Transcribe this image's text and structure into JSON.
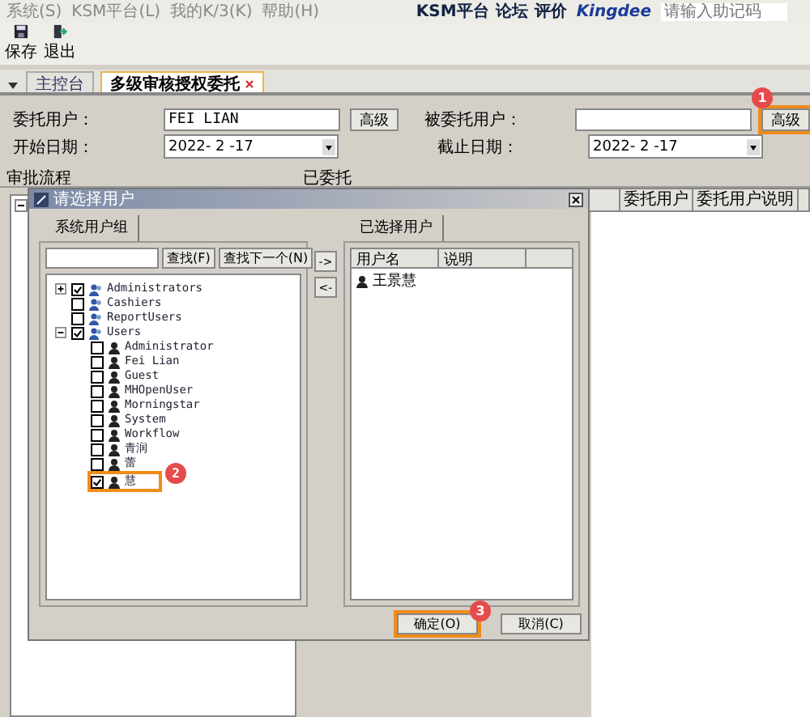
{
  "menu": [
    "系统(S)",
    "KSM平台(L)",
    "我的K/3(K)",
    "帮助(H)"
  ],
  "header_links": [
    "KSM平台",
    "论坛",
    "评价"
  ],
  "brand": "Kingdee",
  "search": {
    "placeholder": "请输入助记码"
  },
  "toolbar": [
    {
      "kind": "save",
      "label": "保存"
    },
    {
      "kind": "exit",
      "label": "退出"
    }
  ],
  "tabs": [
    {
      "label": "主控台",
      "selected": false,
      "closable": false
    },
    {
      "label": "多级审核授权委托",
      "selected": true,
      "closable": true
    }
  ],
  "form_rows": [
    [
      {
        "kind": "text",
        "label": "委托用户：",
        "value": "FEI LIAN",
        "button": "高级"
      },
      {
        "kind": "text",
        "label": "被委托用户：",
        "button": "高级",
        "callout": "1"
      }
    ],
    [
      {
        "kind": "date",
        "label": "开始日期：",
        "value": "2022- 2 -17"
      },
      {
        "kind": "date",
        "label": "截止日期：",
        "value": "2022- 2 -17"
      }
    ]
  ],
  "panels": {
    "left_title": "审批流程",
    "right_title": "已委托",
    "columns": [
      "委托用户",
      "委托用户说明"
    ]
  },
  "dialog": {
    "title": "请选择用户",
    "left_tab": "系统用户组",
    "search_buttons": [
      "查找(F)",
      "查找下一个(N)"
    ],
    "tree": [
      {
        "label": "Administrators",
        "checked": true,
        "expanded": false
      },
      {
        "label": "Cashiers",
        "checked": false
      },
      {
        "label": "ReportUsers",
        "checked": false
      },
      {
        "label": "Users",
        "checked": true,
        "expanded": true,
        "children": [
          {
            "label": "Administrator",
            "checked": false
          },
          {
            "label": "Fei Lian",
            "checked": false
          },
          {
            "label": "Guest",
            "checked": false
          },
          {
            "label": "MHOpenUser",
            "checked": false
          },
          {
            "label": "Morningstar",
            "checked": false
          },
          {
            "label": "System",
            "checked": false
          },
          {
            "label": "Workflow",
            "checked": false
          },
          {
            "label": "青润",
            "checked": false
          },
          {
            "label": "蕾",
            "checked": false
          },
          {
            "label": "慧",
            "checked": true,
            "callout": "2"
          }
        ]
      }
    ],
    "move_buttons": [
      "->",
      "<-"
    ],
    "right_tab": "已选择用户",
    "columns": [
      "用户名",
      "说明"
    ],
    "rows": [
      {
        "name": "王景慧"
      }
    ],
    "buttons": [
      {
        "label": "确定(O)",
        "callout": "3"
      },
      {
        "label": "取消(C)"
      }
    ]
  }
}
